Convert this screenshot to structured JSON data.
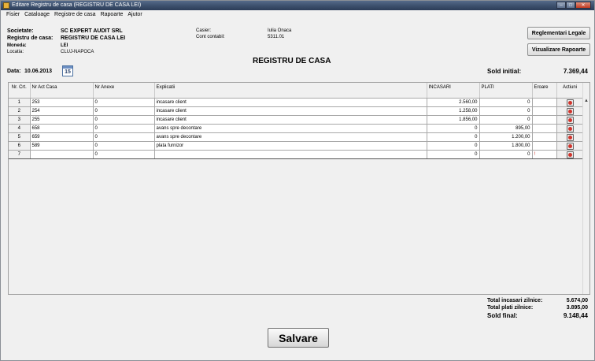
{
  "window": {
    "title": "Editare Registru de casa (REGISTRU DE CASA LEI)",
    "controls": {
      "minimize": "–",
      "maximize": "□",
      "close": "✕"
    }
  },
  "menu": [
    "Fisier",
    "Cataloage",
    "Registre de casa",
    "Rapoarte",
    "Ajutor"
  ],
  "header": {
    "societate_label": "Societate:",
    "societate_value": "SC EXPERT AUDIT SRL",
    "registru_label": "Registru de casa:",
    "registru_value": "REGISTRU DE CASA LEI",
    "moneda_label": "Moneda:",
    "moneda_value": "LEI",
    "locatia_label": "Locatia:",
    "locatia_value": "CLUJ-NAPOCA",
    "casier_label": "Casier:",
    "casier_value": "Iulia Onaca",
    "cont_label": "Cont contabil:",
    "cont_value": "5311.01",
    "report_title": "REGISTRU DE CASA",
    "data_label": "Data:",
    "data_value": "10.06.2013",
    "calendar_day": "15",
    "sold_initial_label": "Sold initial:",
    "sold_initial_value": "7.369,44"
  },
  "buttons": {
    "reglementari": "Reglementari Legale",
    "vizualizare": "Vizualizare Rapoarte",
    "save": "Salvare"
  },
  "table": {
    "columns": [
      "Nr. Crt.",
      "Nr Act Casa",
      "Nr Anexe",
      "Explicatii",
      "INCASARI",
      "PLATI",
      "Eroare",
      "Actiuni"
    ],
    "rows": [
      {
        "nr": "1",
        "act": "253",
        "anexe": "0",
        "expl": "incasare client",
        "inc": "2.560,00",
        "plati": "0",
        "err": ""
      },
      {
        "nr": "2",
        "act": "254",
        "anexe": "0",
        "expl": "incasare client",
        "inc": "1.258,00",
        "plati": "0",
        "err": ""
      },
      {
        "nr": "3",
        "act": "255",
        "anexe": "0",
        "expl": "incasare client",
        "inc": "1.856,00",
        "plati": "0",
        "err": ""
      },
      {
        "nr": "4",
        "act": "658",
        "anexe": "0",
        "expl": "avans spre decontare",
        "inc": "0",
        "plati": "895,00",
        "err": ""
      },
      {
        "nr": "5",
        "act": "659",
        "anexe": "0",
        "expl": "avans spre decontare",
        "inc": "0",
        "plati": "1.200,00",
        "err": ""
      },
      {
        "nr": "6",
        "act": "589",
        "anexe": "0",
        "expl": "plata furnizor",
        "inc": "0",
        "plati": "1.800,00",
        "err": ""
      },
      {
        "nr": "7",
        "act": "",
        "anexe": "0",
        "expl": "",
        "inc": "0",
        "plati": "0",
        "err": "!"
      }
    ]
  },
  "totals": {
    "incasari_label": "Total incasari zilnice:",
    "incasari_value": "5.674,00",
    "plati_label": "Total plati zilnice:",
    "plati_value": "3.895,00",
    "sold_final_label": "Sold final:",
    "sold_final_value": "9.148,44"
  }
}
